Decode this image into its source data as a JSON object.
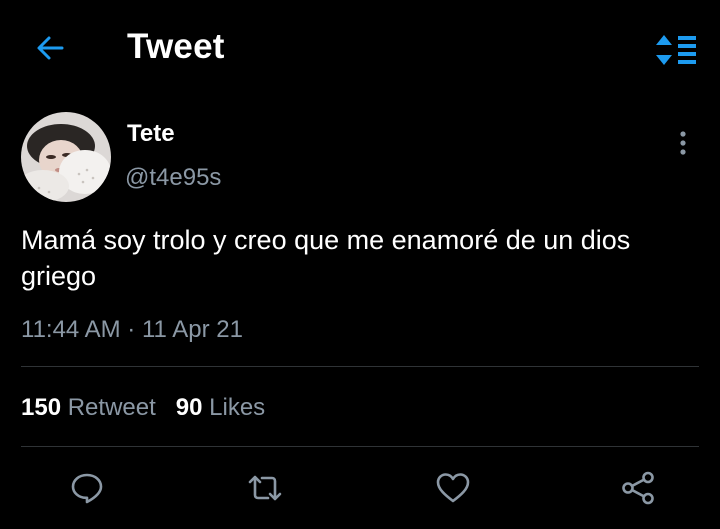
{
  "header": {
    "title": "Tweet",
    "back_icon": "arrow-left-icon",
    "sort_icon": "sort-list-icon"
  },
  "tweet": {
    "display_name": "Tete",
    "handle": "@t4e95s",
    "text": "Mamá soy trolo y creo que me enamoré de un dios griego",
    "time": "11:44 AM",
    "separator": "·",
    "date": "11 Apr 21"
  },
  "stats": {
    "retweets": "150",
    "retweet_label": "Retweet",
    "likes": "90",
    "likes_label": "Likes"
  },
  "actions": {
    "reply_icon": "reply-icon",
    "retweet_icon": "retweet-icon",
    "like_icon": "heart-icon",
    "share_icon": "share-icon"
  },
  "colors": {
    "background": "#000000",
    "accent": "#1d9bf0",
    "secondary_text": "#8b98a5",
    "divider": "#2f3336"
  }
}
